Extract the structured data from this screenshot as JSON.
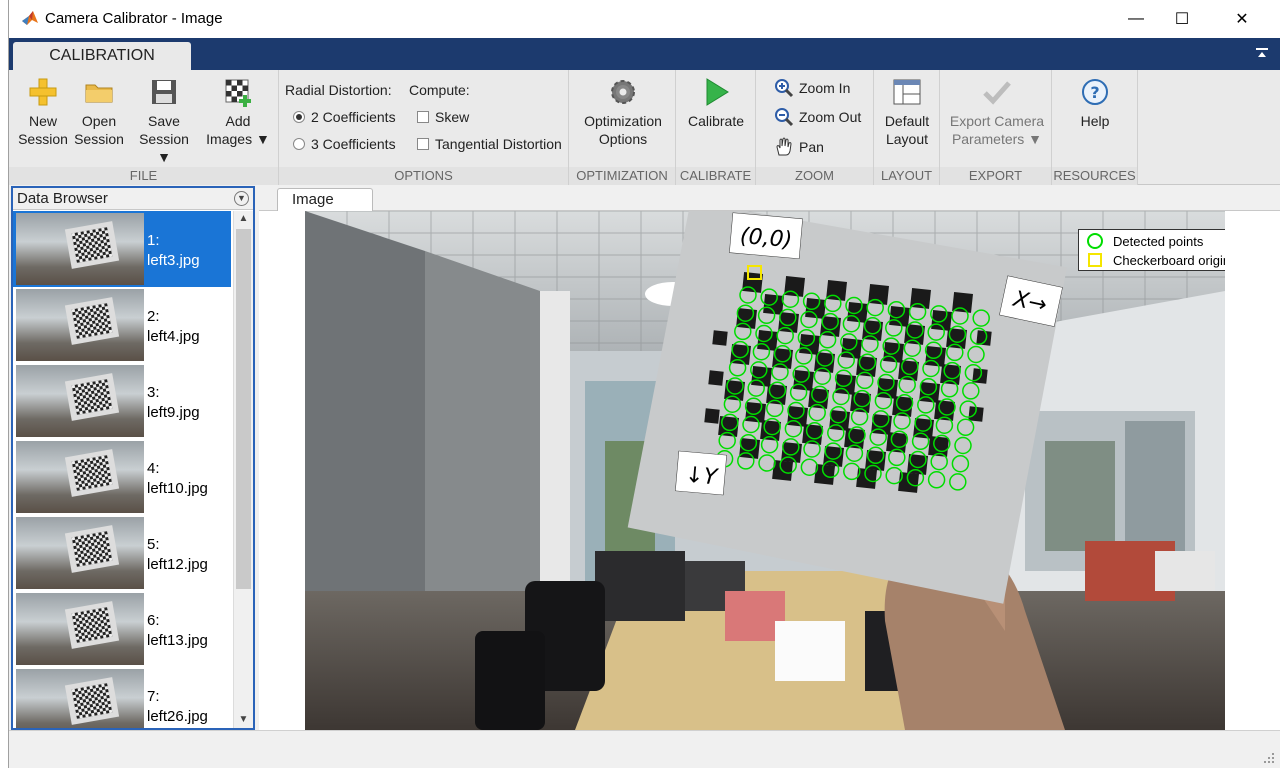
{
  "window": {
    "title": "Camera Calibrator - Image",
    "minimize": "—",
    "maximize": "☐",
    "close": "✕"
  },
  "ribbon": {
    "tab": "CALIBRATION",
    "file": {
      "label": "FILE",
      "new_session": [
        "New",
        "Session"
      ],
      "open_session": [
        "Open",
        "Session"
      ],
      "save_session": [
        "Save",
        "Session ▼"
      ],
      "add_images": [
        "Add",
        "Images ▼"
      ]
    },
    "options": {
      "label": "OPTIONS",
      "radial_distortion": "Radial Distortion:",
      "coef2": "2 Coefficients",
      "coef3": "3 Coefficients",
      "compute": "Compute:",
      "skew": "Skew",
      "tangential": "Tangential Distortion"
    },
    "optimization": {
      "label": "OPTIMIZATION",
      "button": [
        "Optimization",
        "Options"
      ]
    },
    "calibrate": {
      "label": "CALIBRATE",
      "button": "Calibrate"
    },
    "zoom": {
      "label": "ZOOM",
      "zoom_in": "Zoom In",
      "zoom_out": "Zoom Out",
      "pan": "Pan"
    },
    "layout": {
      "label": "LAYOUT",
      "button": [
        "Default",
        "Layout"
      ]
    },
    "export": {
      "label": "EXPORT",
      "button": [
        "Export Camera",
        "Parameters ▼"
      ]
    },
    "resources": {
      "label": "RESOURCES",
      "button": "Help"
    }
  },
  "data_browser": {
    "title": "Data Browser",
    "items": [
      {
        "num": "1:",
        "file": "left3.jpg",
        "selected": true
      },
      {
        "num": "2:",
        "file": "left4.jpg",
        "selected": false
      },
      {
        "num": "3:",
        "file": "left9.jpg",
        "selected": false
      },
      {
        "num": "4:",
        "file": "left10.jpg",
        "selected": false
      },
      {
        "num": "5:",
        "file": "left12.jpg",
        "selected": false
      },
      {
        "num": "6:",
        "file": "left13.jpg",
        "selected": false
      },
      {
        "num": "7:",
        "file": "left26.jpg",
        "selected": false
      }
    ]
  },
  "image_tab": {
    "label": "Image"
  },
  "overlay": {
    "origin_label": "(0,0)",
    "x_label": "X→",
    "y_label": "↓Y",
    "legend": {
      "detected": "Detected points",
      "origin": "Checkerboard origin"
    },
    "colors": {
      "detected": "#00dd00",
      "origin": "#f5e600"
    }
  }
}
